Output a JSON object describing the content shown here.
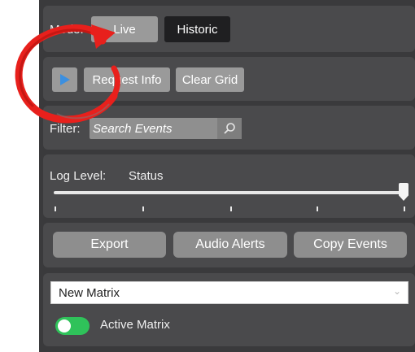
{
  "mode": {
    "label": "Mode:",
    "options": [
      "Live",
      "Historic"
    ],
    "selected": "Historic"
  },
  "controls": {
    "request_info": "Request Info",
    "clear_grid": "Clear Grid"
  },
  "filter": {
    "label": "Filter:",
    "placeholder": "Search Events"
  },
  "log_level": {
    "label": "Log Level:",
    "value": "Status",
    "slider_fraction": 1.0,
    "tick_count": 5
  },
  "actions": {
    "export": "Export",
    "audio_alerts": "Audio Alerts",
    "copy_events": "Copy Events"
  },
  "matrix": {
    "selected": "New Matrix",
    "active_label": "Active Matrix",
    "active": true
  },
  "colors": {
    "play_icon": "#3b8fe0",
    "toggle_on": "#2fc25a",
    "annotation": "#e8201c"
  },
  "icons": [
    "play-icon",
    "search-icon",
    "chevron-down-icon",
    "refresh-arrow-annotation"
  ]
}
